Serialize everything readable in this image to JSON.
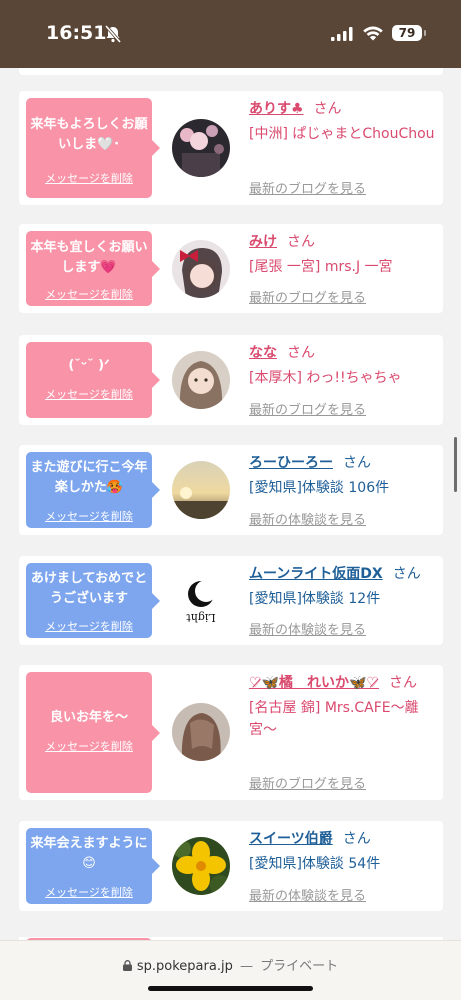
{
  "status_bar": {
    "time": "16:51",
    "battery": "79"
  },
  "messages": [
    {
      "bubble_color": "pink",
      "bubble_text": "来年もよろしくお願いしま🤍･",
      "delete_label": "メッセージを削除",
      "name": "ありす♣",
      "san": "さん",
      "sub": "[中洲] ぱじゃまとChouChou",
      "latest_link": "最新のブログを見る",
      "name_color": "pink"
    },
    {
      "bubble_color": "pink",
      "bubble_text": "本年も宜しくお願いします💗",
      "delete_label": "メッセージを削除",
      "name": "みけ",
      "san": "さん",
      "sub": "[尾張 一宮] mrs.J 一宮",
      "latest_link": "最新のブログを見る",
      "name_color": "pink"
    },
    {
      "bubble_color": "pink",
      "bubble_text": "(˘ᵕ˘ )ᐟ",
      "delete_label": "メッセージを削除",
      "name": "なな",
      "san": "さん",
      "sub": "[本厚木] わっ!!ちゃちゃ",
      "latest_link": "最新のブログを見る",
      "name_color": "pink"
    },
    {
      "bubble_color": "blue",
      "bubble_text": "また遊びに行こ今年楽しかた🥵",
      "delete_label": "メッセージを削除",
      "name": "ろーひーろー",
      "san": "さん",
      "sub": "[愛知県]体験談 106件",
      "latest_link": "最新の体験談を見る",
      "name_color": "blue"
    },
    {
      "bubble_color": "blue",
      "bubble_text": "あけましておめでとうございます",
      "delete_label": "メッセージを削除",
      "name": "ムーンライト仮面DX",
      "san": "さん",
      "sub": "[愛知県]体験談 12件",
      "latest_link": "最新の体験談を見る",
      "name_color": "blue",
      "avatar_text": "Light"
    },
    {
      "bubble_color": "pink",
      "bubble_text": "良いお年を〜",
      "delete_label": "メッセージを削除",
      "name": "♡̷🦋橘　れいか🦋♡̷",
      "san": "さん",
      "sub": "[名古屋 錦] Mrs.CAFE〜離宮〜",
      "latest_link": "最新のブログを見る",
      "name_color": "pink"
    },
    {
      "bubble_color": "blue",
      "bubble_text": "来年会えますように😊",
      "delete_label": "メッセージを削除",
      "name": "スイーツ伯爵",
      "san": "さん",
      "sub": "[愛知県]体験談 54件",
      "latest_link": "最新の体験談を見る",
      "name_color": "blue"
    }
  ],
  "browser": {
    "url": "sp.pokepara.jp",
    "separator": "—",
    "privacy": "プライベート"
  }
}
